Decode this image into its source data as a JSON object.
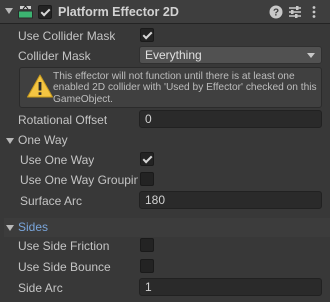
{
  "component": {
    "title": "Platform Effector 2D",
    "enabled": true
  },
  "props": {
    "use_collider_mask": {
      "label": "Use Collider Mask",
      "checked": true
    },
    "collider_mask": {
      "label": "Collider Mask",
      "value": "Everything"
    },
    "warning": "This effector will not function until there is at least one enabled 2D collider with 'Used by Effector' checked on this GameObject.",
    "rotational_offset": {
      "label": "Rotational Offset",
      "value": "0"
    }
  },
  "one_way": {
    "title": "One Way",
    "use_one_way": {
      "label": "Use One Way",
      "checked": true
    },
    "use_one_way_grouping": {
      "label": "Use One Way Groupin",
      "checked": false
    },
    "surface_arc": {
      "label": "Surface Arc",
      "value": "180"
    }
  },
  "sides": {
    "title": "Sides",
    "use_side_friction": {
      "label": "Use Side Friction",
      "checked": false
    },
    "use_side_bounce": {
      "label": "Use Side Bounce",
      "checked": false
    },
    "side_arc": {
      "label": "Side Arc",
      "value": "1"
    }
  },
  "icons": {
    "fold": "triangle-down-icon",
    "component": "platform-effector-icon",
    "help": "help-icon",
    "presets": "presets-icon",
    "menu": "kebab-menu-icon",
    "warning": "warning-icon"
  },
  "colors": {
    "background": "#383838",
    "field": "#2a2a2a",
    "warning": "#f4c542",
    "accent": "#7aa6dc"
  }
}
